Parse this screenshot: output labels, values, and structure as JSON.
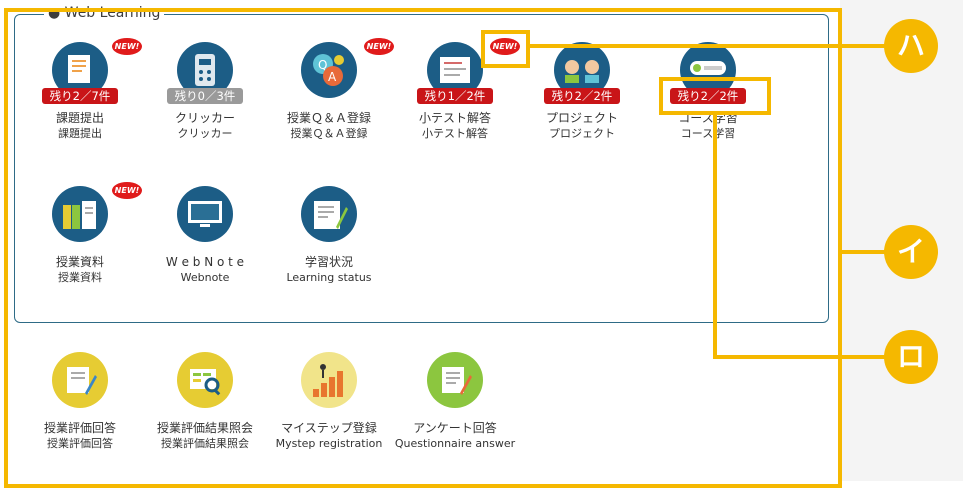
{
  "group": {
    "legend": "● Web Learning"
  },
  "items": [
    {
      "line1": "課題提出",
      "line2": "課題提出",
      "badge": "残り2／7件",
      "new": "NEW!",
      "icon": "document-icon"
    },
    {
      "line1": "クリッカー",
      "line2": "クリッカー",
      "badge": "残り0／3件",
      "icon": "clicker-icon"
    },
    {
      "line1": "授業Ｑ＆Ａ登録",
      "line2": "授業Ｑ＆Ａ登録",
      "new": "NEW!",
      "icon": "qa-icon"
    },
    {
      "line1": "小テスト解答",
      "line2": "小テスト解答",
      "badge": "残り1／2件",
      "new": "NEW!",
      "icon": "quiz-icon"
    },
    {
      "line1": "プロジェクト",
      "line2": "プロジェクト",
      "badge": "残り2／2件",
      "icon": "project-icon"
    },
    {
      "line1": "コース学習",
      "line2": "コース学習",
      "badge": "残り2／2件",
      "icon": "course-icon"
    },
    {
      "line1": "授業資料",
      "line2": "授業資料",
      "new": "NEW!",
      "icon": "materials-icon"
    },
    {
      "line1": "W e b N o t e",
      "line2": "Webnote",
      "icon": "webnote-icon"
    },
    {
      "line1": "学習状況",
      "line2": "Learning status",
      "icon": "learning-status-icon"
    }
  ],
  "bottom_items": [
    {
      "line1": "授業評価回答",
      "line2": "授業評価回答",
      "icon": "evaluation-answer-icon"
    },
    {
      "line1": "授業評価結果照会",
      "line2": "授業評価結果照会",
      "icon": "evaluation-results-icon"
    },
    {
      "line1": "マイステップ登録",
      "line2": "Mystep registration",
      "icon": "mystep-icon"
    },
    {
      "line1": "アンケート回答",
      "line2": "Questionnaire answer",
      "icon": "questionnaire-icon"
    }
  ],
  "markers": {
    "ha": "ハ",
    "i": "イ",
    "ro": "ロ"
  },
  "colors": {
    "navy": "#1c5d86",
    "badge_red": "#c91518",
    "highlight": "#f5b800"
  }
}
